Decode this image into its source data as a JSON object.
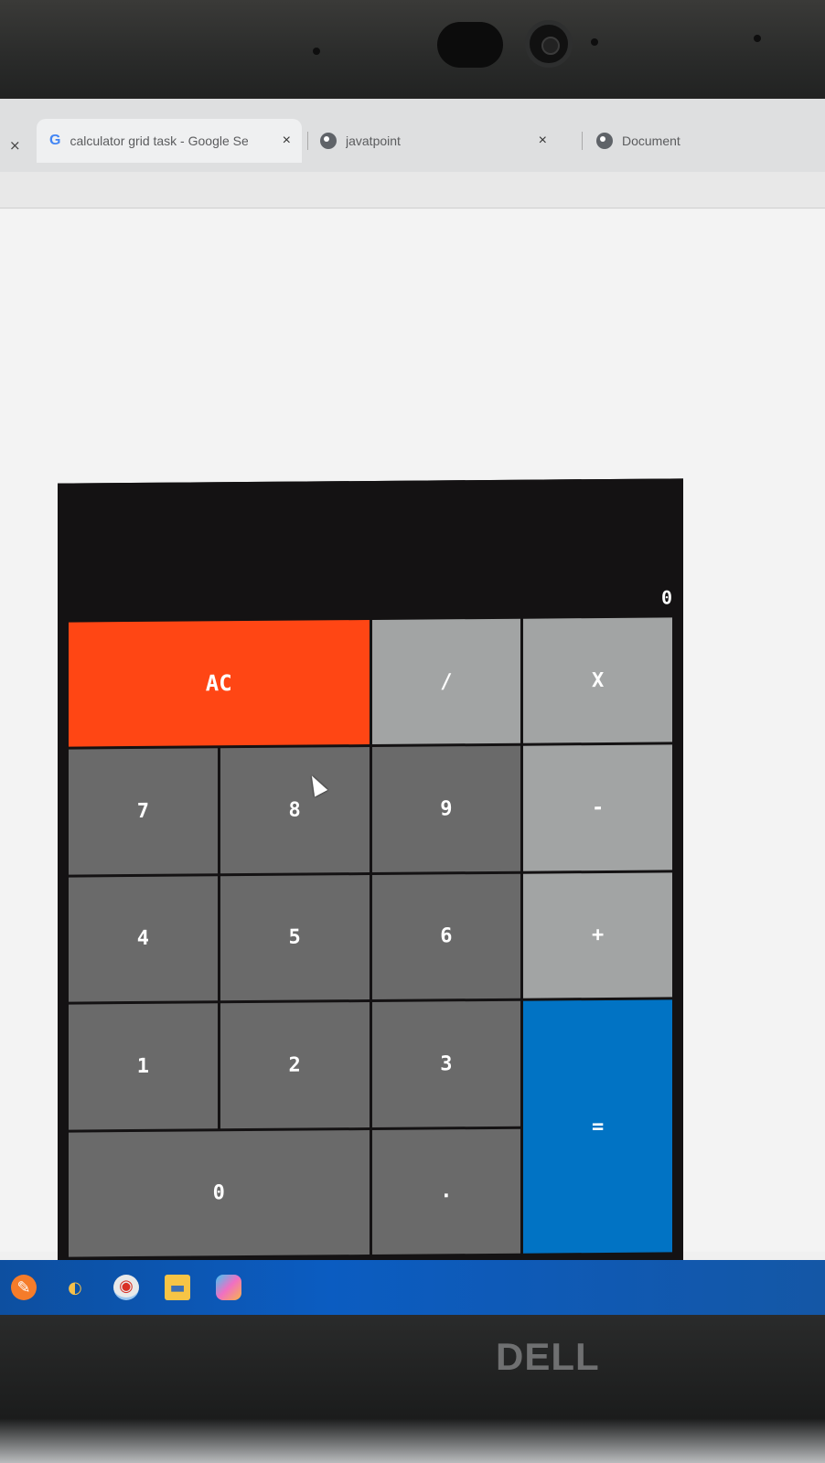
{
  "browser": {
    "tabs": [
      {
        "label": "calculator grid task - Google Se",
        "icon": "google-icon",
        "active": true
      },
      {
        "label": "javatpoint",
        "icon": "globe-icon",
        "active": false
      },
      {
        "label": "Document",
        "icon": "globe-icon",
        "active": false
      }
    ],
    "close_glyph": "×"
  },
  "calculator": {
    "display_value": "0",
    "keys": {
      "clear": "AC",
      "divide": "/",
      "multiply": "X",
      "seven": "7",
      "eight": "8",
      "nine": "9",
      "minus": "-",
      "four": "4",
      "five": "5",
      "six": "6",
      "plus": "+",
      "one": "1",
      "two": "2",
      "three": "3",
      "equals": "=",
      "zero": "0",
      "decimal": "."
    },
    "colors": {
      "display_bg": "#141213",
      "digit_key": "#6a6a6a",
      "operator_key": "#a2a4a4",
      "clear_key": "#ff4614",
      "equals_key": "#0173c4"
    }
  },
  "taskbar": {
    "icons": [
      "pinned-app-icon",
      "edge-icon",
      "chrome-icon",
      "file-explorer-icon",
      "copilot-icon"
    ]
  },
  "bezel": {
    "brand": "DELL"
  }
}
